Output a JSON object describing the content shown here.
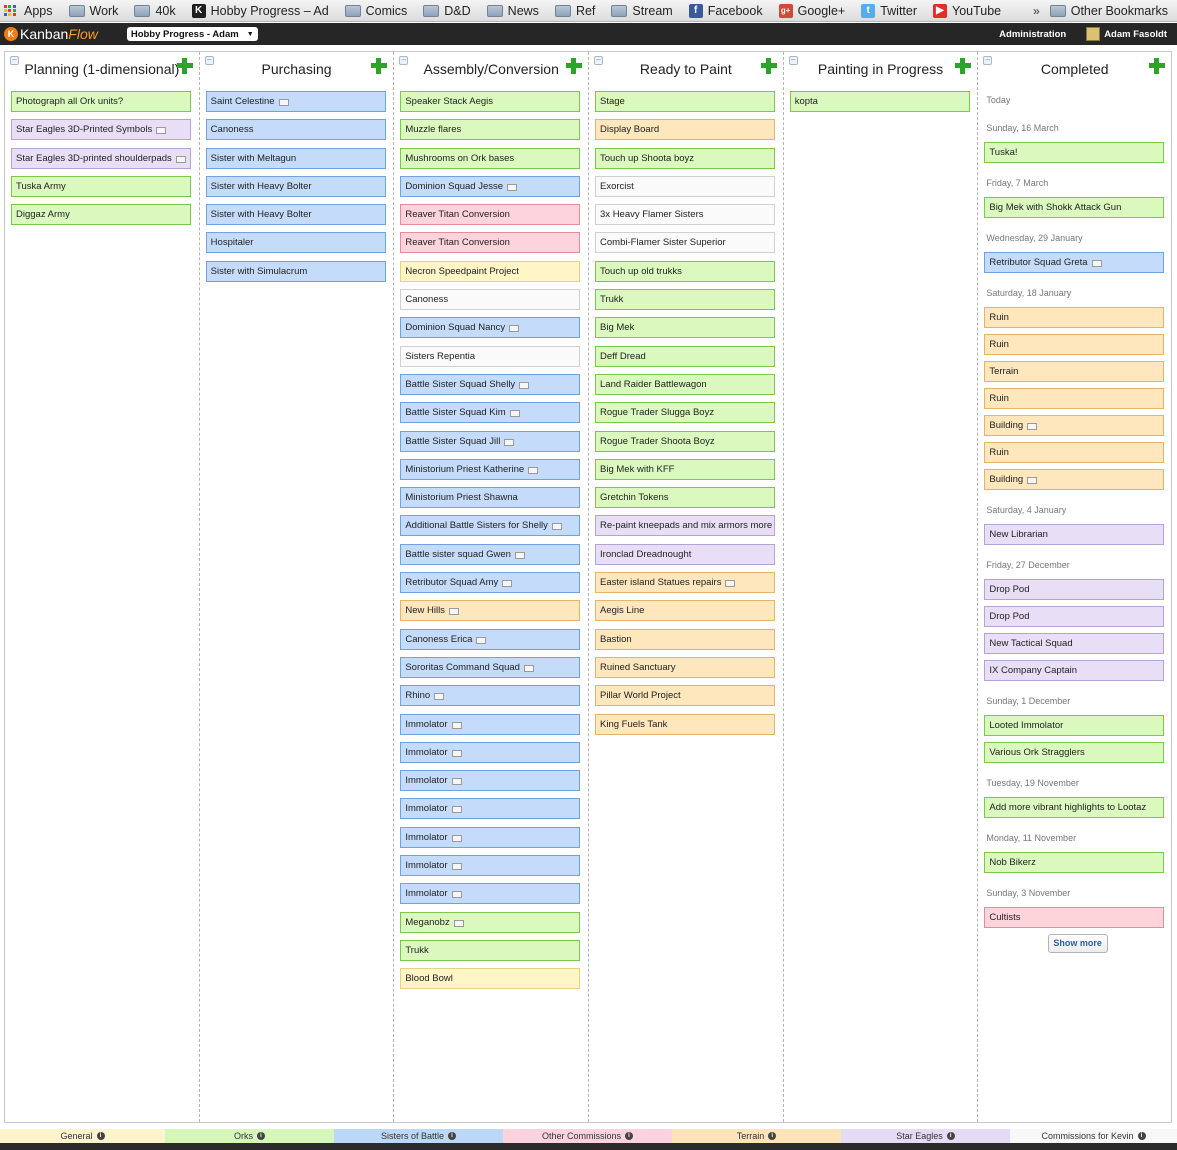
{
  "bookmarks": {
    "apps_label": "Apps",
    "items": [
      {
        "label": "Work",
        "icon": "folder-icon"
      },
      {
        "label": "40k",
        "icon": "folder-icon"
      },
      {
        "label": "Hobby Progress – Ad",
        "icon": "kanbanflow-icon"
      },
      {
        "label": "Comics",
        "icon": "folder-icon"
      },
      {
        "label": "D&D",
        "icon": "folder-icon"
      },
      {
        "label": "News",
        "icon": "folder-icon"
      },
      {
        "label": "Ref",
        "icon": "folder-icon"
      },
      {
        "label": "Stream",
        "icon": "folder-icon"
      },
      {
        "label": "Facebook",
        "icon": "facebook-icon"
      },
      {
        "label": "Google+",
        "icon": "google-plus-icon"
      },
      {
        "label": "Twitter",
        "icon": "twitter-icon"
      },
      {
        "label": "YouTube",
        "icon": "youtube-icon"
      }
    ],
    "overflow": "»",
    "other": "Other Bookmarks"
  },
  "header": {
    "logo_a": "Kanban",
    "logo_b": "Flow",
    "board_name": "Hobby Progress - Adam",
    "admin": "Administration",
    "user": "Adam Fasoldt"
  },
  "columns": [
    {
      "title": "Planning (1-dimensional)",
      "cards": [
        {
          "text": "Photograph all Ork units?",
          "color": "green"
        },
        {
          "text": "Star Eagles 3D-Printed Symbols",
          "color": "purple",
          "note": true
        },
        {
          "text": "Star Eagles 3D-printed shoulderpads",
          "color": "purple",
          "note": true
        },
        {
          "text": "Tuska Army",
          "color": "green"
        },
        {
          "text": "Diggaz Army",
          "color": "green"
        }
      ]
    },
    {
      "title": "Purchasing",
      "cards": [
        {
          "text": "Saint Celestine",
          "color": "blue",
          "note": true
        },
        {
          "text": "Canoness",
          "color": "blue"
        },
        {
          "text": "Sister with Meltagun",
          "color": "blue"
        },
        {
          "text": "Sister with Heavy Bolter",
          "color": "blue"
        },
        {
          "text": "Sister with Heavy Bolter",
          "color": "blue"
        },
        {
          "text": "Hospitaler",
          "color": "blue"
        },
        {
          "text": "Sister with Simulacrum",
          "color": "blue"
        }
      ]
    },
    {
      "title": "Assembly/Conversion",
      "cards": [
        {
          "text": "Speaker Stack Aegis",
          "color": "green"
        },
        {
          "text": "Muzzle flares",
          "color": "green"
        },
        {
          "text": "Mushrooms on Ork bases",
          "color": "green"
        },
        {
          "text": "Dominion Squad Jesse",
          "color": "blue",
          "note": true
        },
        {
          "text": "Reaver Titan Conversion",
          "color": "pink"
        },
        {
          "text": "Reaver Titan Conversion",
          "color": "pink"
        },
        {
          "text": "Necron Speedpaint Project",
          "color": "yellow"
        },
        {
          "text": "Canoness",
          "color": "white"
        },
        {
          "text": "Dominion Squad Nancy",
          "color": "blue",
          "note": true
        },
        {
          "text": "Sisters Repentia",
          "color": "white"
        },
        {
          "text": "Battle Sister Squad Shelly",
          "color": "blue",
          "note": true
        },
        {
          "text": "Battle Sister Squad Kim",
          "color": "blue",
          "note": true
        },
        {
          "text": "Battle Sister Squad Jill",
          "color": "blue",
          "note": true
        },
        {
          "text": "Ministorium Priest Katherine",
          "color": "blue",
          "note": true
        },
        {
          "text": "Ministorium Priest Shawna",
          "color": "blue"
        },
        {
          "text": "Additional Battle Sisters for Shelly",
          "color": "blue",
          "note": true
        },
        {
          "text": "Battle sister squad Gwen",
          "color": "blue",
          "note": true
        },
        {
          "text": "Retributor Squad Amy",
          "color": "blue",
          "note": true
        },
        {
          "text": "New Hills",
          "color": "orange",
          "note": true
        },
        {
          "text": "Canoness Erica",
          "color": "blue",
          "note": true
        },
        {
          "text": "Sororitas Command Squad",
          "color": "blue",
          "note": true
        },
        {
          "text": "Rhino",
          "color": "blue",
          "note": true
        },
        {
          "text": "Immolator",
          "color": "blue",
          "note": true
        },
        {
          "text": "Immolator",
          "color": "blue",
          "note": true
        },
        {
          "text": "Immolator",
          "color": "blue",
          "note": true
        },
        {
          "text": "Immolator",
          "color": "blue",
          "note": true
        },
        {
          "text": "Immolator",
          "color": "blue",
          "note": true
        },
        {
          "text": "Immolator",
          "color": "blue",
          "note": true
        },
        {
          "text": "Immolator",
          "color": "blue",
          "note": true
        },
        {
          "text": "Meganobz",
          "color": "green",
          "note": true
        },
        {
          "text": "Trukk",
          "color": "green"
        },
        {
          "text": "Blood Bowl",
          "color": "yellow"
        }
      ]
    },
    {
      "title": "Ready to Paint",
      "cards": [
        {
          "text": "Stage",
          "color": "green"
        },
        {
          "text": "Display Board",
          "color": "orange"
        },
        {
          "text": "Touch up Shoota boyz",
          "color": "green"
        },
        {
          "text": "Exorcist",
          "color": "white"
        },
        {
          "text": "3x Heavy Flamer Sisters",
          "color": "white"
        },
        {
          "text": "Combi-Flamer Sister Superior",
          "color": "white"
        },
        {
          "text": "Touch up old trukks",
          "color": "green"
        },
        {
          "text": "Trukk",
          "color": "green"
        },
        {
          "text": "Big Mek",
          "color": "green"
        },
        {
          "text": "Deff Dread",
          "color": "green"
        },
        {
          "text": "Land Raider Battlewagon",
          "color": "green"
        },
        {
          "text": "Rogue Trader Slugga Boyz",
          "color": "green"
        },
        {
          "text": "Rogue Trader Shoota Boyz",
          "color": "green"
        },
        {
          "text": "Big Mek with KFF",
          "color": "green"
        },
        {
          "text": "Gretchin Tokens",
          "color": "green"
        },
        {
          "text": "Re-paint kneepads and mix armors more",
          "color": "purple"
        },
        {
          "text": "Ironclad Dreadnought",
          "color": "purple"
        },
        {
          "text": "Easter island Statues repairs",
          "color": "orange",
          "note": true
        },
        {
          "text": "Aegis Line",
          "color": "orange"
        },
        {
          "text": "Bastion",
          "color": "orange"
        },
        {
          "text": "Ruined Sanctuary",
          "color": "orange"
        },
        {
          "text": "Pillar World Project",
          "color": "orange"
        },
        {
          "text": "King Fuels Tank",
          "color": "orange"
        }
      ]
    },
    {
      "title": "Painting in Progress",
      "cards": [
        {
          "text": "kopta",
          "color": "green"
        }
      ]
    }
  ],
  "completed": {
    "title": "Completed",
    "groups": [
      {
        "day": "Today",
        "cards": []
      },
      {
        "day": "Sunday, 16 March",
        "cards": [
          {
            "text": "Tuska!",
            "color": "green"
          }
        ]
      },
      {
        "day": "Friday, 7 March",
        "cards": [
          {
            "text": "Big Mek with Shokk Attack Gun",
            "color": "green"
          }
        ]
      },
      {
        "day": "Wednesday, 29 January",
        "cards": [
          {
            "text": "Retributor Squad Greta",
            "color": "blue",
            "note": true
          }
        ]
      },
      {
        "day": "Saturday, 18 January",
        "cards": [
          {
            "text": "Ruin",
            "color": "orange"
          },
          {
            "text": "Ruin",
            "color": "orange"
          },
          {
            "text": "Terrain",
            "color": "orange"
          },
          {
            "text": "Ruin",
            "color": "orange"
          },
          {
            "text": "Building",
            "color": "orange",
            "note": true
          },
          {
            "text": "Ruin",
            "color": "orange"
          },
          {
            "text": "Building",
            "color": "orange",
            "note": true
          }
        ]
      },
      {
        "day": "Saturday, 4 January",
        "cards": [
          {
            "text": "New Librarian",
            "color": "purple"
          }
        ]
      },
      {
        "day": "Friday, 27 December",
        "cards": [
          {
            "text": "Drop Pod",
            "color": "purple"
          },
          {
            "text": "Drop Pod",
            "color": "purple"
          },
          {
            "text": "New Tactical Squad",
            "color": "purple"
          },
          {
            "text": "IX Company Captain",
            "color": "purple"
          }
        ]
      },
      {
        "day": "Sunday, 1 December",
        "cards": [
          {
            "text": "Looted Immolator",
            "color": "green"
          },
          {
            "text": "Various Ork Stragglers",
            "color": "green"
          }
        ]
      },
      {
        "day": "Tuesday, 19 November",
        "cards": [
          {
            "text": "Add more vibrant highlights to Lootaz",
            "color": "green"
          }
        ]
      },
      {
        "day": "Monday, 11 November",
        "cards": [
          {
            "text": "Nob Bikerz",
            "color": "green"
          }
        ]
      },
      {
        "day": "Sunday, 3 November",
        "cards": [
          {
            "text": "Cultists",
            "color": "pink"
          }
        ]
      }
    ],
    "show_more": "Show more"
  },
  "legend": [
    {
      "label": "General",
      "color": "#fdf3cc"
    },
    {
      "label": "Orks",
      "color": "#d7f6b9"
    },
    {
      "label": "Sisters of Battle",
      "color": "#bcd8f8"
    },
    {
      "label": "Other Commissions",
      "color": "#fcd3dc"
    },
    {
      "label": "Terrain",
      "color": "#fde4b8"
    },
    {
      "label": "Star Eagles",
      "color": "#e5dbf4"
    },
    {
      "label": "Commissions for Kevin",
      "color": "#f8f8f8"
    }
  ]
}
